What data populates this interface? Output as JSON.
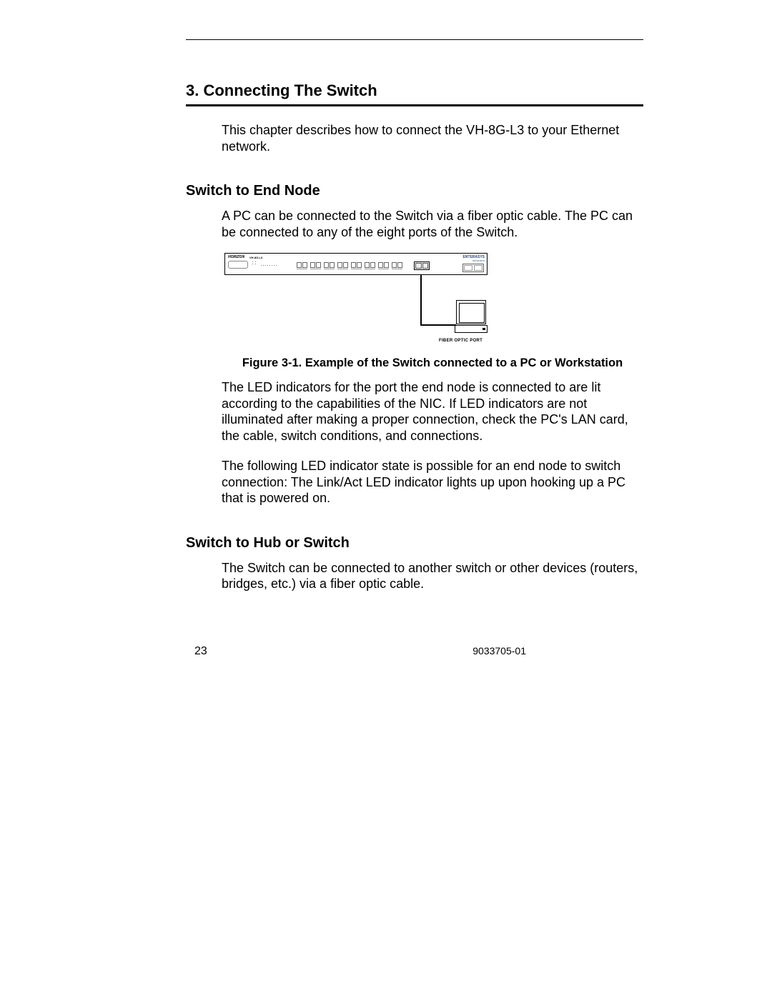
{
  "chapter": {
    "title": "3. Connecting The Switch",
    "intro": "This chapter describes how to connect the VH-8G-L3 to your Ethernet network."
  },
  "section1": {
    "heading": "Switch to End Node",
    "para1": "A PC can be connected to the Switch via a fiber optic cable. The PC can be connected to any of the eight ports of the Switch.",
    "figure": {
      "switch_brand_left": "HORIZON",
      "switch_model": "VH-8G-L3",
      "switch_brand_right": "ENTERASYS",
      "switch_brand_right_sub": "NETWORKS",
      "fiber_label": "FIBER OPTIC PORT",
      "caption": "Figure 3-1.  Example of the Switch connected to a PC or Workstation"
    },
    "para2": "The LED indicators for the port the end node is connected to are lit according to the capabilities of the NIC. If LED indicators are not illuminated after making a proper connection, check the PC's LAN card, the cable, switch conditions, and connections.",
    "para3": "The following LED indicator state is possible for an end node to switch connection: The Link/Act LED indicator lights up upon hooking up a PC that is powered on."
  },
  "section2": {
    "heading": "Switch to Hub or Switch",
    "para1": "The Switch can be connected to another switch or other devices (routers, bridges, etc.) via a fiber optic cable."
  },
  "footer": {
    "page_number": "23",
    "doc_number": "9033705-01"
  }
}
